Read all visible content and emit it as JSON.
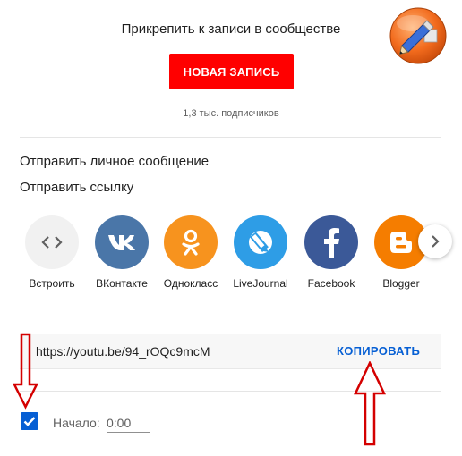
{
  "community": {
    "title": "Прикрепить к записи в сообществе",
    "new_post_label": "НОВАЯ ЗАПИСЬ",
    "subscribers": "1,3 тыс. подписчиков"
  },
  "menu": {
    "send_message": "Отправить личное сообщение",
    "send_link": "Отправить ссылку"
  },
  "share": {
    "items": [
      {
        "label": "Встроить",
        "icon": "embed-icon",
        "color": "#f1f1f1"
      },
      {
        "label": "ВКонтакте",
        "icon": "vk-icon",
        "color": "#4a76a8"
      },
      {
        "label": "Однокласс",
        "icon": "odnoklassniki-icon",
        "color": "#f7931e"
      },
      {
        "label": "LiveJournal",
        "icon": "livejournal-icon",
        "color": "#2e9de6"
      },
      {
        "label": "Facebook",
        "icon": "facebook-icon",
        "color": "#3b5998"
      },
      {
        "label": "Blogger",
        "icon": "blogger-icon",
        "color": "#f57d00"
      }
    ],
    "next_icon": "chevron-right-icon"
  },
  "link": {
    "url": "https://youtu.be/94_rOQc9mcM",
    "copy_label": "КОПИРОВАТЬ"
  },
  "start": {
    "label": "Начало:",
    "value": "0:00",
    "checked": true
  },
  "annotations": {
    "arrow_color": "#d40000",
    "edit_badge_icon": "pencil-icon"
  }
}
